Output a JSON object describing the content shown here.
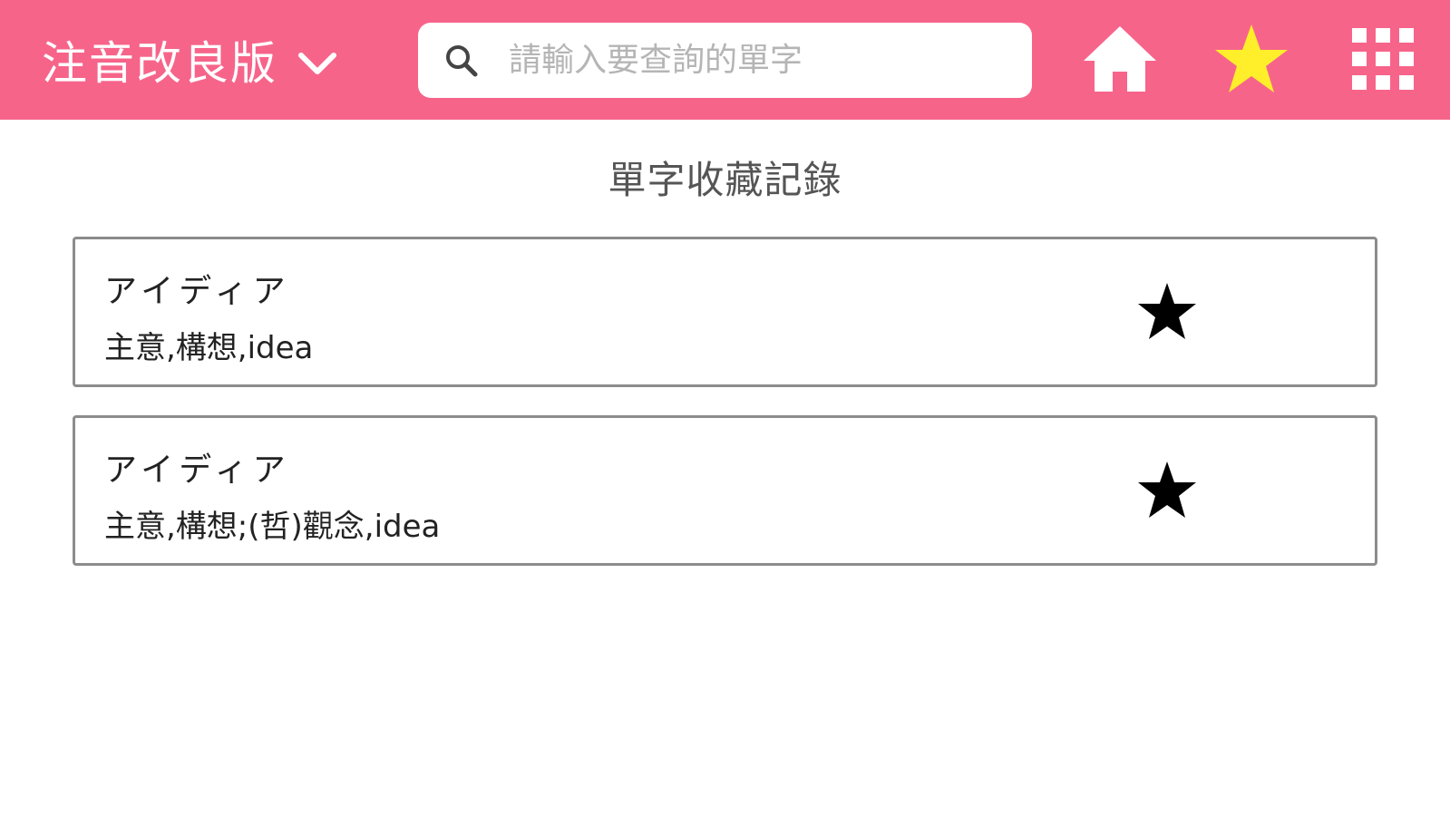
{
  "header": {
    "version_label": "注音改良版",
    "search_placeholder": "請輸入要查詢的單字",
    "search_value": "",
    "nav": {
      "home_icon": "home-icon",
      "favorites_icon": "star-icon",
      "apps_icon": "grid-icon"
    }
  },
  "main": {
    "title": "單字收藏記錄",
    "entries": [
      {
        "term": "アイディア",
        "meaning": "主意,構想,idea",
        "starred": true
      },
      {
        "term": "アイディア",
        "meaning": "主意,構想;(哲)觀念,idea",
        "starred": true
      }
    ]
  },
  "colors": {
    "header_bg": "#f7648a",
    "favorites_active": "#ffef2b",
    "card_border": "#8c8c8c"
  }
}
